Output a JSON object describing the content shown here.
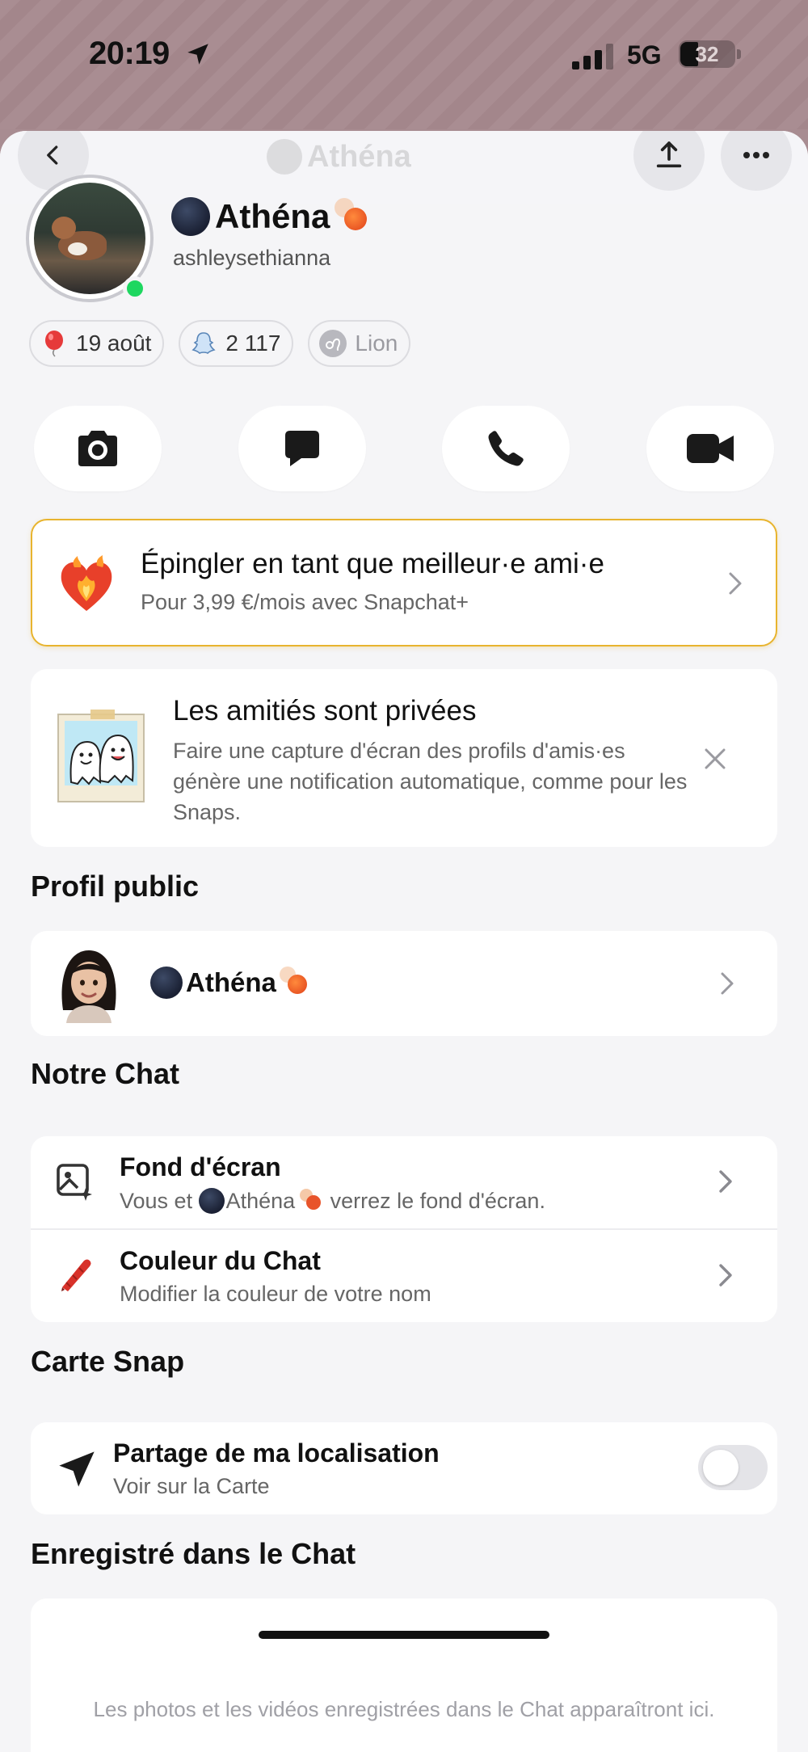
{
  "status_bar": {
    "time": "20:19",
    "network": "5G",
    "battery": "32"
  },
  "header": {
    "ghost_title": "Athéna"
  },
  "profile": {
    "display_name": "Athéna",
    "username": "ashleysethianna",
    "online": true,
    "badges": [
      {
        "icon": "balloon-icon",
        "label": "19 août"
      },
      {
        "icon": "snap-ghost-icon",
        "label": "2 117"
      },
      {
        "icon": "leo-zodiac-icon",
        "label": "Lion"
      }
    ]
  },
  "actions": [
    {
      "icon": "camera-icon"
    },
    {
      "icon": "chat-icon"
    },
    {
      "icon": "phone-icon"
    },
    {
      "icon": "video-icon"
    }
  ],
  "snapchat_plus": {
    "title": "Épingler en tant que meilleur·e ami·e",
    "subtitle": "Pour 3,99 €/mois avec Snapchat+"
  },
  "privacy_card": {
    "title": "Les amitiés sont privées",
    "body": "Faire une capture d'écran des profils d'amis·es génère une notification automatique, comme pour les Snaps."
  },
  "public_profile": {
    "section_title": "Profil public",
    "name": "Athéna"
  },
  "our_chat": {
    "section_title": "Notre Chat",
    "rows": [
      {
        "title": "Fond d'écran",
        "sub_prefix": "Vous et ",
        "sub_name": "Athéna",
        "sub_suffix": " verrez le fond d'écran."
      },
      {
        "title": "Couleur du Chat",
        "subtitle": "Modifier la couleur de votre nom"
      }
    ]
  },
  "snap_map": {
    "section_title": "Carte Snap",
    "title": "Partage de ma localisation",
    "subtitle": "Voir sur la Carte",
    "toggle_on": false
  },
  "saved_in_chat": {
    "section_title": "Enregistré dans le Chat",
    "empty_text": "Les photos et les vidéos enregistrées dans le Chat apparaîtront ici."
  },
  "colors": {
    "accent_gold": "#e8b42e",
    "online_green": "#1ed760"
  }
}
